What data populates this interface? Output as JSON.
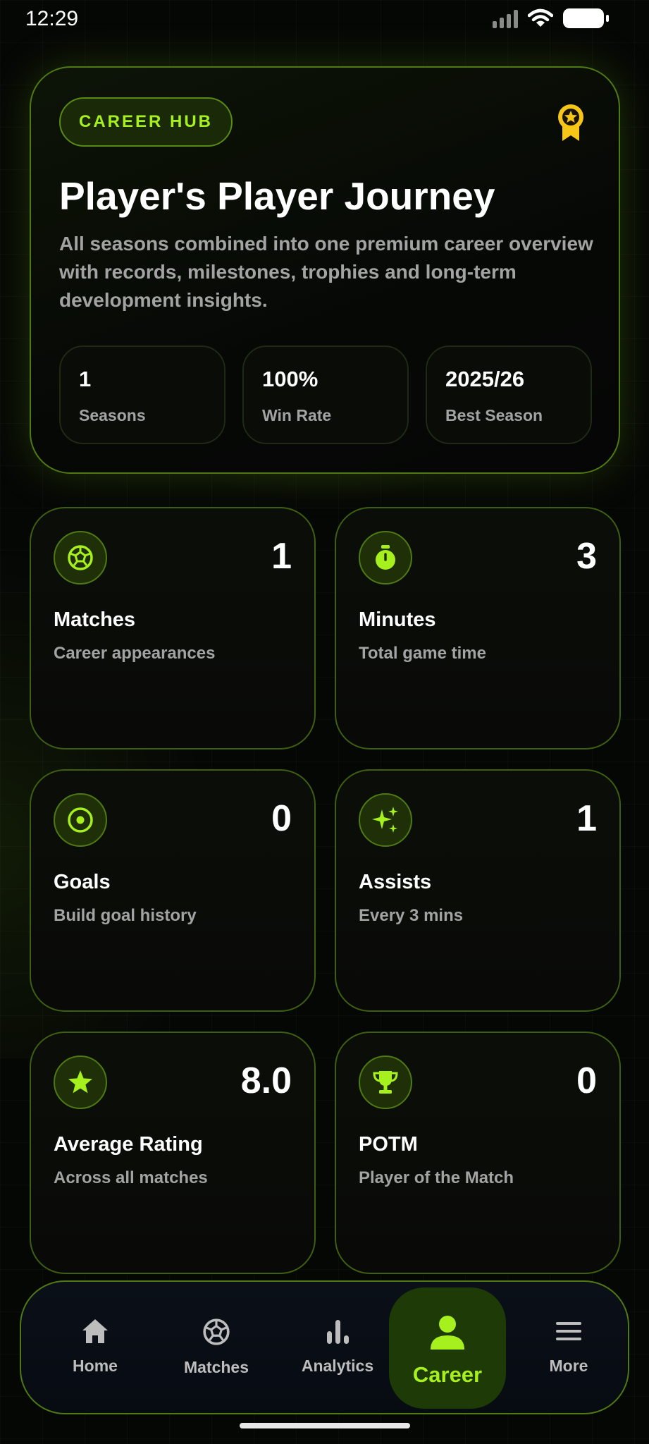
{
  "status_bar": {
    "time": "12:29"
  },
  "hero": {
    "badge": "CAREER HUB",
    "award_icon": "award-ribbon-icon",
    "title": "Player's Player Journey",
    "description": "All seasons combined into one premium career overview with records, milestones, trophies and long-term development insights.",
    "stats": [
      {
        "value": "1",
        "label": "Seasons"
      },
      {
        "value": "100%",
        "label": "Win Rate"
      },
      {
        "value": "2025/26",
        "label": "Best Season"
      }
    ]
  },
  "cards": [
    {
      "icon": "football-icon",
      "value": "1",
      "title": "Matches",
      "subtitle": "Career appearances"
    },
    {
      "icon": "stopwatch-icon",
      "value": "3",
      "title": "Minutes",
      "subtitle": "Total game time"
    },
    {
      "icon": "target-icon",
      "value": "0",
      "title": "Goals",
      "subtitle": "Build goal history"
    },
    {
      "icon": "sparkles-icon",
      "value": "1",
      "title": "Assists",
      "subtitle": "Every 3 mins"
    },
    {
      "icon": "star-icon",
      "value": "8.0",
      "title": "Average Rating",
      "subtitle": "Across all matches"
    },
    {
      "icon": "trophy-icon",
      "value": "0",
      "title": "POTM",
      "subtitle": "Player of the Match"
    }
  ],
  "nav": {
    "items": [
      {
        "label": "Home",
        "icon": "home-icon"
      },
      {
        "label": "Matches",
        "icon": "football-icon"
      },
      {
        "label": "Analytics",
        "icon": "bar-chart-icon"
      },
      {
        "label": "Career",
        "icon": "person-icon",
        "active": true
      },
      {
        "label": "More",
        "icon": "menu-icon"
      }
    ]
  },
  "colors": {
    "accent": "#a6f01e",
    "gold": "#f5c518",
    "muted_text": "#a3a3a3"
  }
}
